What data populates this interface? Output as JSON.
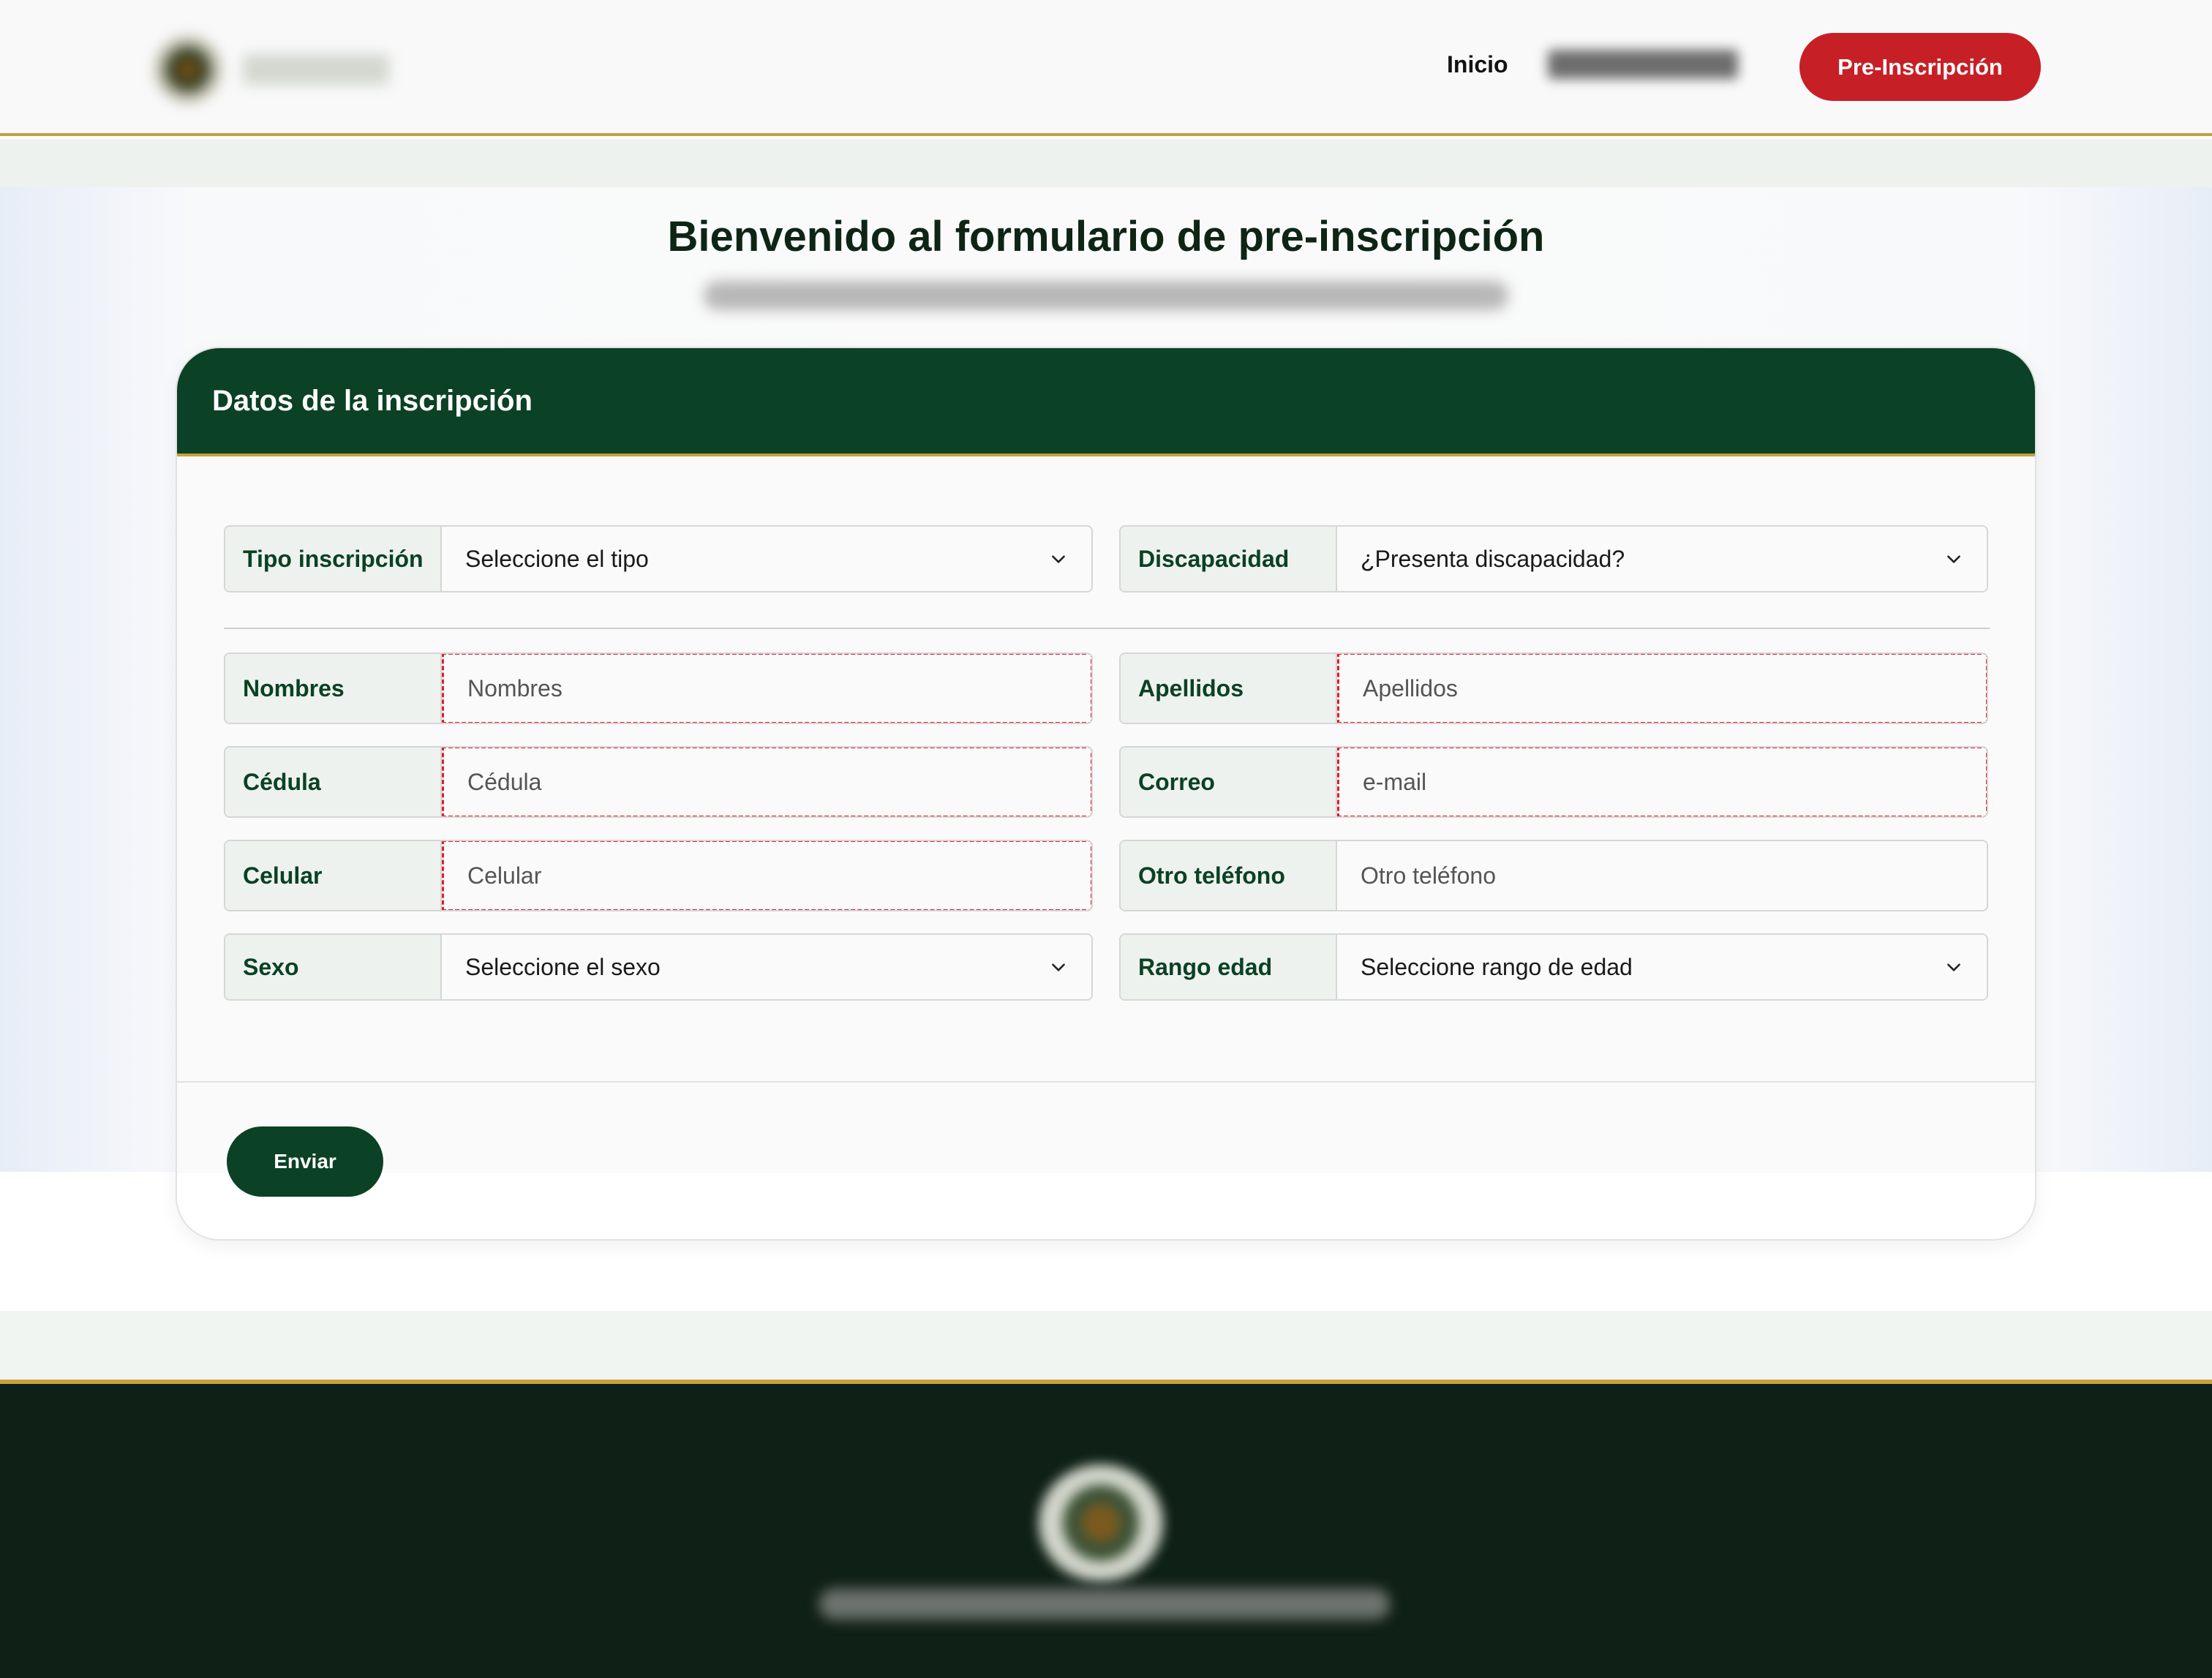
{
  "header": {
    "nav_inicio": "Inicio",
    "cta_label": "Pre-Inscripción"
  },
  "page": {
    "title": "Bienvenido al formulario de pre-inscripción"
  },
  "form": {
    "section_title": "Datos de la inscripción",
    "tipo_inscripcion": {
      "label": "Tipo inscripción",
      "value": "Seleccione el tipo"
    },
    "discapacidad": {
      "label": "Discapacidad",
      "value": "¿Presenta discapacidad?"
    },
    "nombres": {
      "label": "Nombres",
      "placeholder": "Nombres"
    },
    "apellidos": {
      "label": "Apellidos",
      "placeholder": "Apellidos"
    },
    "cedula": {
      "label": "Cédula",
      "placeholder": "Cédula"
    },
    "correo": {
      "label": "Correo",
      "placeholder": "e-mail"
    },
    "celular": {
      "label": "Celular",
      "placeholder": "Celular"
    },
    "otro_telefono": {
      "label": "Otro teléfono",
      "placeholder": "Otro teléfono"
    },
    "sexo": {
      "label": "Sexo",
      "value": "Seleccione el sexo"
    },
    "rango_edad": {
      "label": "Rango edad",
      "value": "Seleccione rango de edad"
    },
    "submit_label": "Enviar"
  },
  "icons": {
    "select_caret": "chevron-down-icon"
  },
  "colors": {
    "brand_green": "#0b4124",
    "accent_gold": "#c8a13e",
    "cta_red": "#c62026",
    "required_outline": "#e01e2a",
    "footer_bg": "#0f2016"
  }
}
